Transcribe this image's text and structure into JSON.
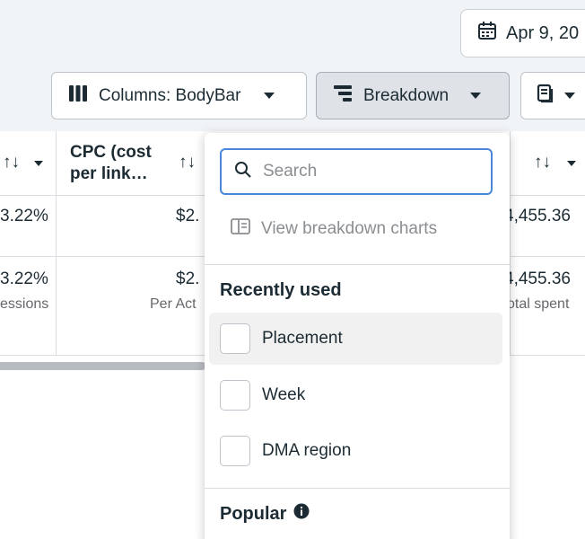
{
  "header": {
    "date_label": "Apr 9, 20"
  },
  "toolbar": {
    "columns_label": "Columns: BodyBar",
    "breakdown_label": "Breakdown"
  },
  "table": {
    "headers": {
      "cpc_line1": "CPC (cost",
      "cpc_line2": "per link…",
      "sort_symbol": "↑↓"
    },
    "rows": [
      {
        "left_value": "3.22%",
        "mid_value": "$2.",
        "right_value": "4,455.36"
      },
      {
        "left_value": "3.22%",
        "left_sub": "essions",
        "mid_value": "$2.",
        "mid_sub": "Per Act",
        "right_value": "4,455.36",
        "right_sub": "otal spent"
      }
    ]
  },
  "breakdown_menu": {
    "search_placeholder": "Search",
    "view_charts_label": "View breakdown charts",
    "recently_used_title": "Recently used",
    "recently_used": [
      "Placement",
      "Week",
      "DMA region"
    ],
    "popular_title": "Popular"
  },
  "icons": {
    "calendar": "calendar-icon",
    "columns": "columns-icon",
    "breakdown": "breakdown-icon",
    "reports": "reports-icon",
    "search": "search-icon",
    "charts": "chart-panel-icon",
    "info": "info-icon"
  },
  "colors": {
    "accent_focus": "#4a86d9",
    "text_primary": "#1c2b33",
    "text_muted": "#8a8d91",
    "toolbar_bg": "#f1f4f7"
  }
}
